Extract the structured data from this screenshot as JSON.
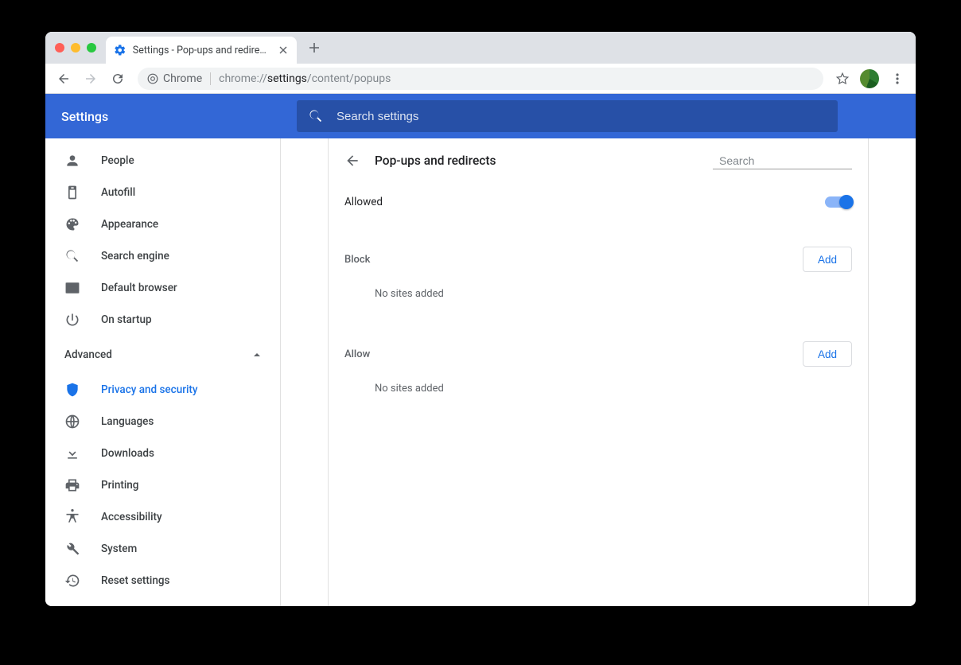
{
  "tab": {
    "title": "Settings - Pop-ups and redirects"
  },
  "omnibox": {
    "site_label": "Chrome",
    "url_pre": "chrome://",
    "url_dark": "settings",
    "url_post": "/content/popups"
  },
  "header": {
    "app_title": "Settings",
    "search_placeholder": "Search settings"
  },
  "sidebar": {
    "items_top": [
      {
        "icon": "person",
        "label": "People"
      },
      {
        "icon": "autofill",
        "label": "Autofill"
      },
      {
        "icon": "palette",
        "label": "Appearance"
      },
      {
        "icon": "search",
        "label": "Search engine"
      },
      {
        "icon": "browser",
        "label": "Default browser"
      },
      {
        "icon": "power",
        "label": "On startup"
      }
    ],
    "advanced_label": "Advanced",
    "items_bottom": [
      {
        "icon": "shield",
        "label": "Privacy and security",
        "active": true
      },
      {
        "icon": "globe",
        "label": "Languages"
      },
      {
        "icon": "download",
        "label": "Downloads"
      },
      {
        "icon": "print",
        "label": "Printing"
      },
      {
        "icon": "accessibility",
        "label": "Accessibility"
      },
      {
        "icon": "wrench",
        "label": "System"
      },
      {
        "icon": "restore",
        "label": "Reset settings"
      }
    ]
  },
  "content": {
    "title": "Pop-ups and redirects",
    "search_placeholder": "Search",
    "allowed_label": "Allowed",
    "allowed_value": true,
    "block": {
      "title": "Block",
      "add_label": "Add",
      "empty": "No sites added"
    },
    "allow": {
      "title": "Allow",
      "add_label": "Add",
      "empty": "No sites added"
    }
  }
}
